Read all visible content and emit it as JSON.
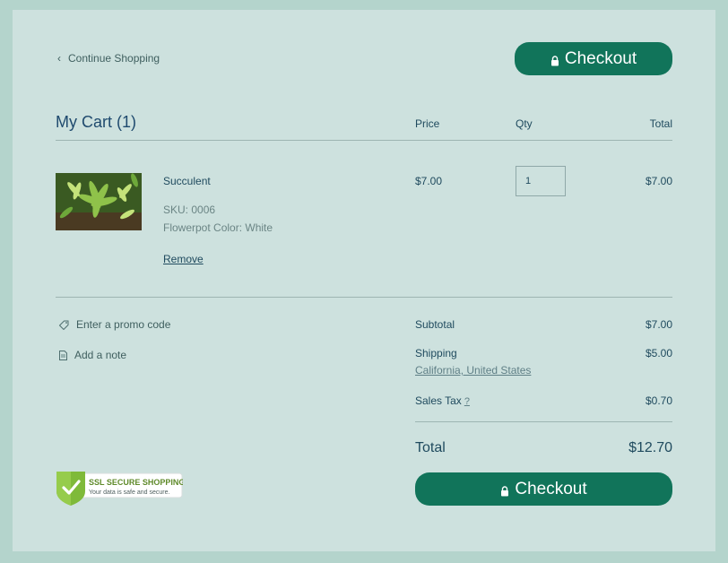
{
  "header": {
    "continue_label": "Continue Shopping",
    "checkout_label": "Checkout"
  },
  "cart": {
    "title": "My Cart (1)",
    "columns": {
      "price": "Price",
      "qty": "Qty",
      "total": "Total"
    },
    "items": [
      {
        "name": "Succulent",
        "sku": "SKU: 0006",
        "option": "Flowerpot Color: White",
        "remove_label": "Remove",
        "price": "$7.00",
        "qty": "1",
        "total": "$7.00"
      }
    ]
  },
  "links": {
    "promo": "Enter a promo code",
    "note": "Add a note"
  },
  "summary": {
    "subtotal_label": "Subtotal",
    "subtotal": "$7.00",
    "shipping_label": "Shipping",
    "shipping": "$5.00",
    "shipping_destination": "California, United States",
    "tax_label": "Sales Tax",
    "tax_help": "?",
    "tax": "$0.70",
    "total_label": "Total",
    "total": "$12.70",
    "checkout_label": "Checkout"
  },
  "badge": {
    "title": "SSL SECURE SHOPPING",
    "subtitle": "Your data is safe and secure."
  },
  "colors": {
    "accent": "#11745a",
    "background": "#b4d4cc",
    "panel": "#cde1de"
  }
}
